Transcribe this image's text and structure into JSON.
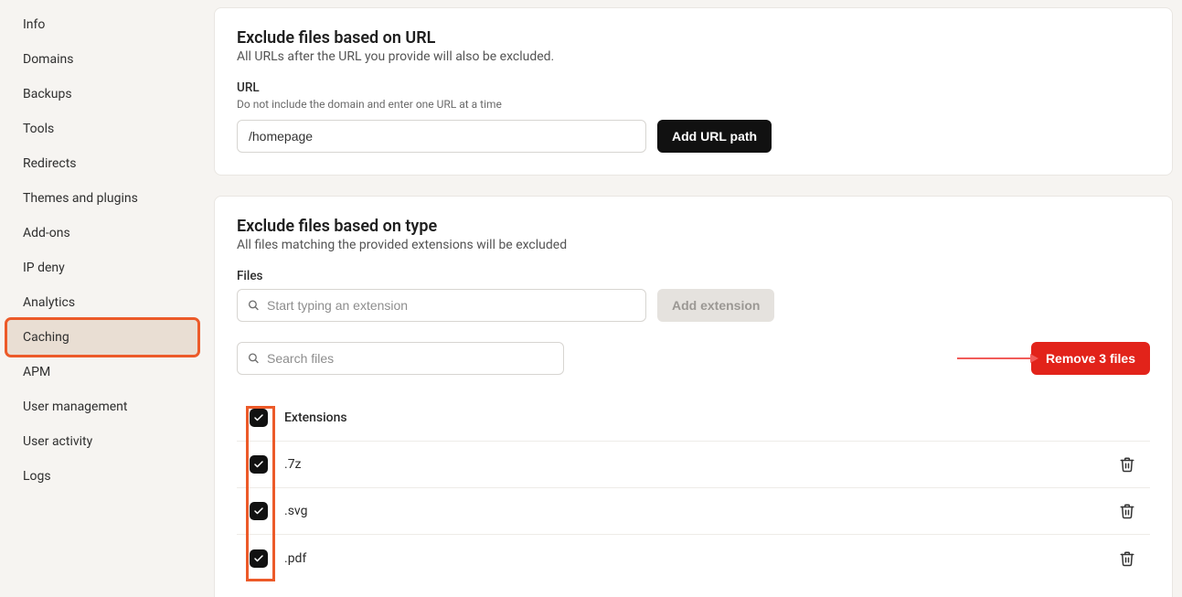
{
  "sidebar": {
    "items": [
      {
        "label": "Info"
      },
      {
        "label": "Domains"
      },
      {
        "label": "Backups"
      },
      {
        "label": "Tools"
      },
      {
        "label": "Redirects"
      },
      {
        "label": "Themes and plugins"
      },
      {
        "label": "Add-ons"
      },
      {
        "label": "IP deny"
      },
      {
        "label": "Analytics"
      },
      {
        "label": "Caching"
      },
      {
        "label": "APM"
      },
      {
        "label": "User management"
      },
      {
        "label": "User activity"
      },
      {
        "label": "Logs"
      }
    ],
    "active_index": 9
  },
  "url_panel": {
    "title": "Exclude files based on URL",
    "subtitle": "All URLs after the URL you provide will also be excluded.",
    "field_label": "URL",
    "field_hint": "Do not include the domain and enter one URL at a time",
    "input_value": "/homepage",
    "button": "Add URL path"
  },
  "type_panel": {
    "title": "Exclude files based on type",
    "subtitle": "All files matching the provided extensions will be excluded",
    "field_label": "Files",
    "add_input_placeholder": "Start typing an extension",
    "add_button": "Add extension",
    "search_placeholder": "Search files",
    "remove_button": "Remove 3 files",
    "header": "Extensions",
    "rows": [
      {
        "ext": ".7z"
      },
      {
        "ext": ".svg"
      },
      {
        "ext": ".pdf"
      }
    ]
  }
}
